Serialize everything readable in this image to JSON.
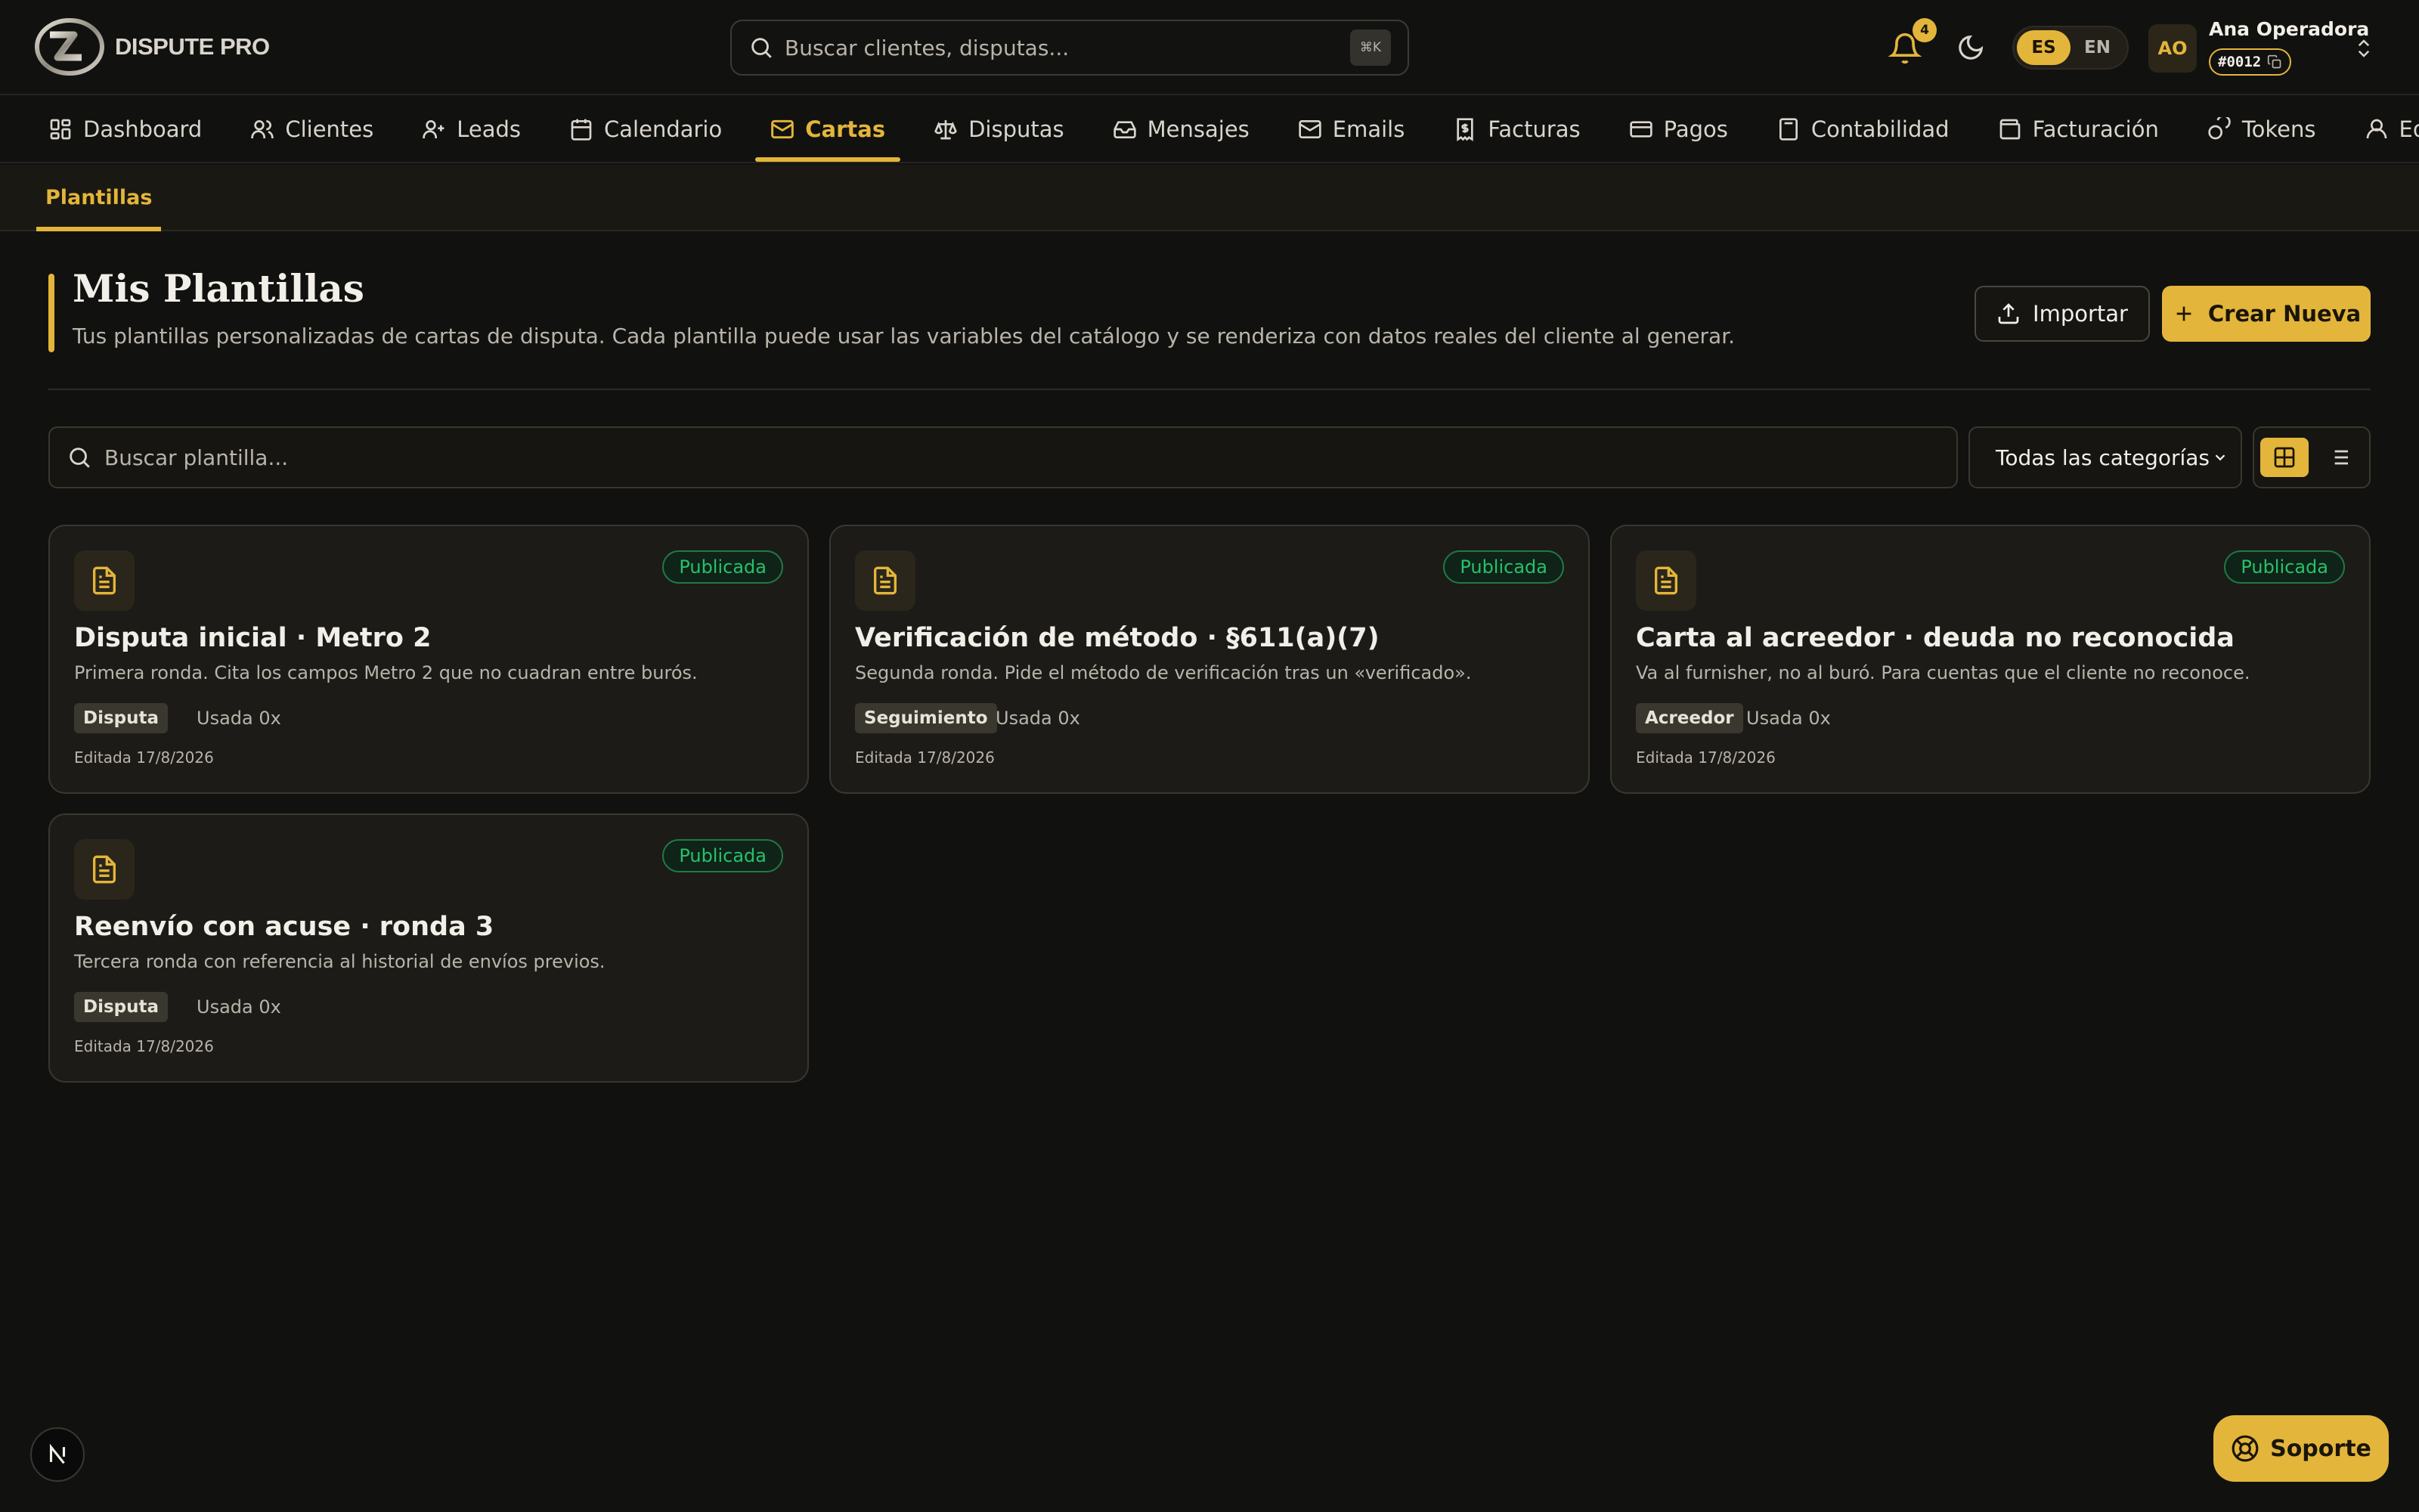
{
  "brand": {
    "name": "DISPUTE PRO"
  },
  "topbar": {
    "search_placeholder": "Buscar clientes, disputas...",
    "search_shortcut": "⌘K",
    "notifications_count": "4",
    "languages": [
      "ES",
      "EN"
    ],
    "active_language": "ES",
    "user": {
      "initials": "AO",
      "name": "Ana Operadora",
      "id": "#0012"
    }
  },
  "nav": {
    "items": [
      {
        "label": "Dashboard",
        "icon": "dashboard-icon"
      },
      {
        "label": "Clientes",
        "icon": "users-icon"
      },
      {
        "label": "Leads",
        "icon": "user-plus-icon"
      },
      {
        "label": "Calendario",
        "icon": "calendar-icon"
      },
      {
        "label": "Cartas",
        "icon": "mail-icon"
      },
      {
        "label": "Disputas",
        "icon": "scale-icon"
      },
      {
        "label": "Mensajes",
        "icon": "inbox-icon"
      },
      {
        "label": "Emails",
        "icon": "envelope-icon"
      },
      {
        "label": "Facturas",
        "icon": "invoice-icon"
      },
      {
        "label": "Pagos",
        "icon": "credit-card-icon"
      },
      {
        "label": "Contabilidad",
        "icon": "calculator-icon"
      },
      {
        "label": "Facturación",
        "icon": "wallet-icon"
      },
      {
        "label": "Tokens",
        "icon": "coins-icon"
      },
      {
        "label": "Equipo",
        "icon": "user-icon"
      }
    ],
    "active": "Cartas"
  },
  "subnav": {
    "tabs": [
      "Plantillas"
    ],
    "active": "Plantillas"
  },
  "page": {
    "title": "Mis Plantillas",
    "subtitle": "Tus plantillas personalizadas de cartas de disputa. Cada plantilla puede usar las variables del catálogo y se renderiza con datos reales del cliente al generar.",
    "import_label": "Importar",
    "create_label": "Crear Nueva"
  },
  "filters": {
    "search_placeholder": "Buscar plantilla...",
    "category_selected": "Todas las categorías",
    "view_mode": "grid"
  },
  "templates": [
    {
      "title": "Disputa inicial · Metro 2",
      "description": "Primera ronda. Cita los campos Metro 2 que no cuadran entre burós.",
      "status": "Publicada",
      "category": "Disputa",
      "usage": "Usada 0x",
      "edited": "Editada 17/8/2026"
    },
    {
      "title": "Verificación de método · §611(a)(7)",
      "description": "Segunda ronda. Pide el método de verificación tras un «verificado».",
      "status": "Publicada",
      "category": "Seguimiento",
      "usage": "Usada 0x",
      "edited": "Editada 17/8/2026"
    },
    {
      "title": "Carta al acreedor · deuda no reconocida",
      "description": "Va al furnisher, no al buró. Para cuentas que el cliente no reconoce.",
      "status": "Publicada",
      "category": "Acreedor",
      "usage": "Usada 0x",
      "edited": "Editada 17/8/2026"
    },
    {
      "title": "Reenvío con acuse · ronda 3",
      "description": "Tercera ronda con referencia al historial de envíos previos.",
      "status": "Publicada",
      "category": "Disputa",
      "usage": "Usada 0x",
      "edited": "Editada 17/8/2026"
    }
  ],
  "support": {
    "label": "Soporte"
  },
  "colors": {
    "accent": "#e3b53a",
    "background": "#111110",
    "success": "#27c16a"
  }
}
